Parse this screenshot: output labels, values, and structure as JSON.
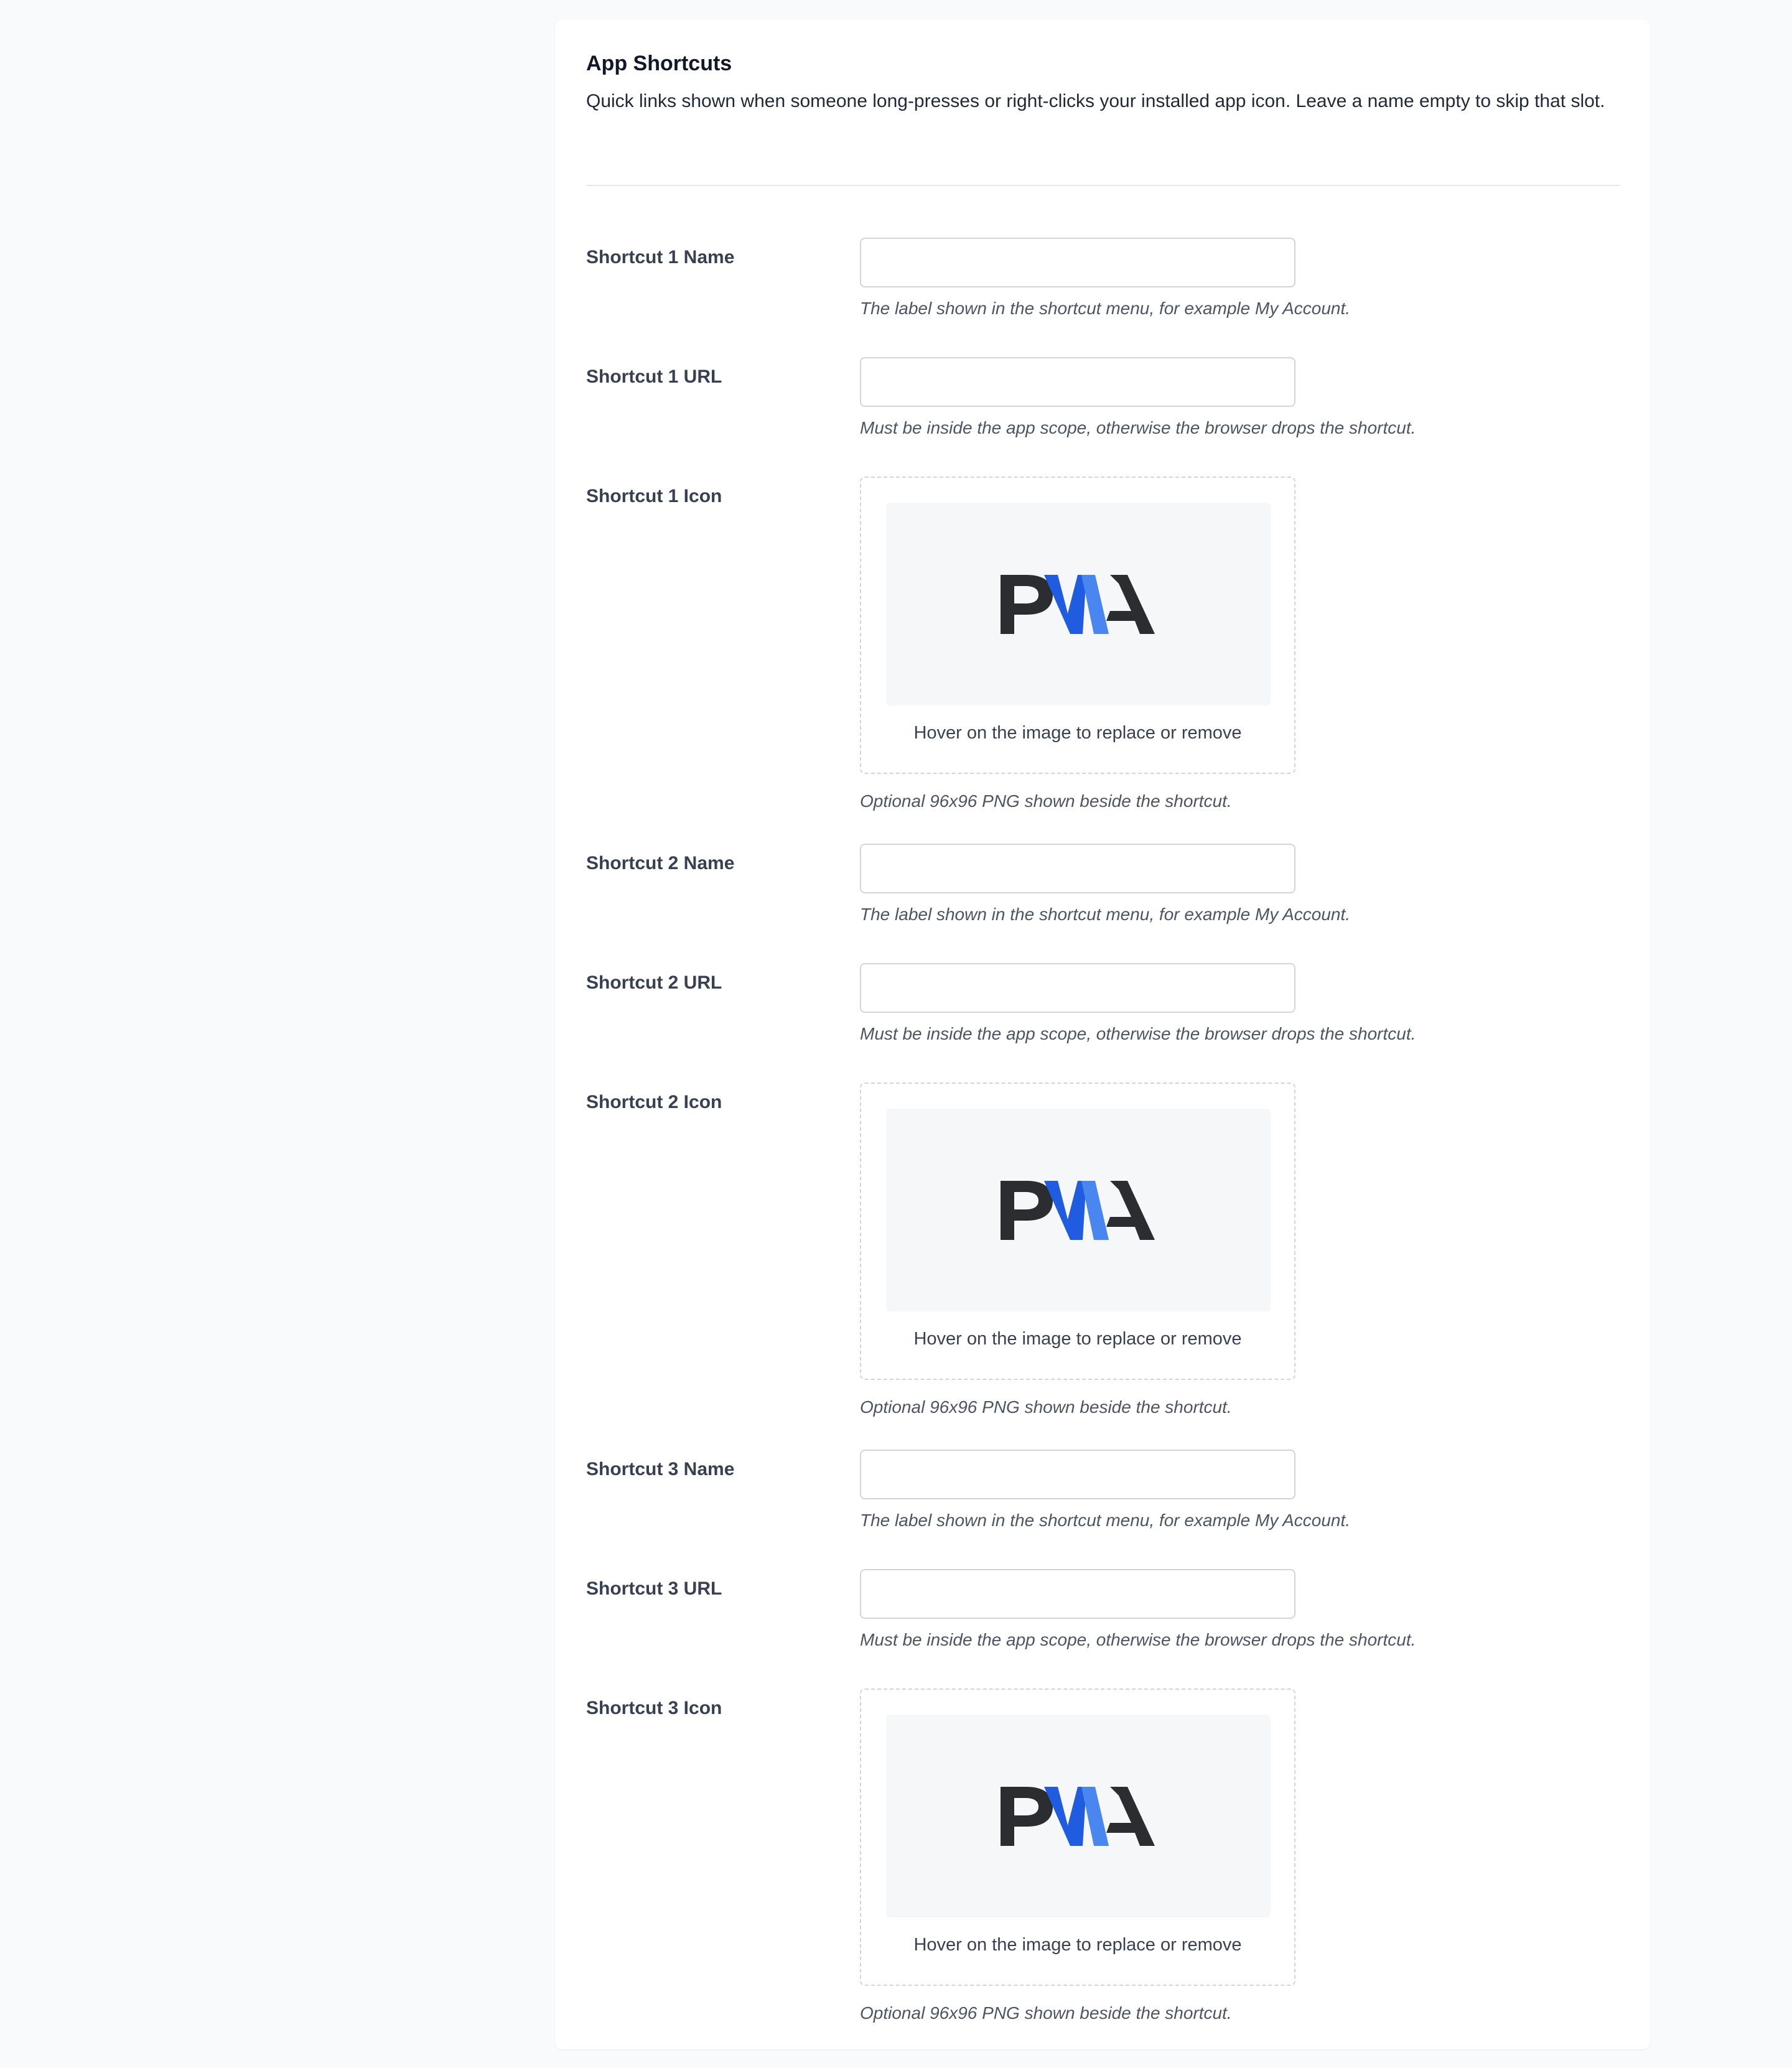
{
  "section": {
    "title": "App Shortcuts",
    "description": "Quick links shown when someone long-presses or right-clicks your installed app icon. Leave a name empty to skip that slot."
  },
  "shortcuts": [
    {
      "name_label": "Shortcut 1 Name",
      "name_value": "",
      "name_help": "The label shown in the shortcut menu, for example My Account.",
      "url_label": "Shortcut 1 URL",
      "url_value": "",
      "url_help": "Must be inside the app scope, otherwise the browser drops the shortcut.",
      "icon_label": "Shortcut 1 Icon",
      "icon_caption": "Hover on the image to replace or remove",
      "icon_help": "Optional 96x96 PNG shown beside the shortcut.",
      "icon_image": "pwa-logo"
    },
    {
      "name_label": "Shortcut 2 Name",
      "name_value": "",
      "name_help": "The label shown in the shortcut menu, for example My Account.",
      "url_label": "Shortcut 2 URL",
      "url_value": "",
      "url_help": "Must be inside the app scope, otherwise the browser drops the shortcut.",
      "icon_label": "Shortcut 2 Icon",
      "icon_caption": "Hover on the image to replace or remove",
      "icon_help": "Optional 96x96 PNG shown beside the shortcut.",
      "icon_image": "pwa-logo"
    },
    {
      "name_label": "Shortcut 3 Name",
      "name_value": "",
      "name_help": "The label shown in the shortcut menu, for example My Account.",
      "url_label": "Shortcut 3 URL",
      "url_value": "",
      "url_help": "Must be inside the app scope, otherwise the browser drops the shortcut.",
      "icon_label": "Shortcut 3 Icon",
      "icon_caption": "Hover on the image to replace or remove",
      "icon_help": "Optional 96x96 PNG shown beside the shortcut.",
      "icon_image": "pwa-logo"
    }
  ],
  "logo": {
    "text": "PWA",
    "dark_color": "#2b2d31",
    "blue_color": "#1f5ce0",
    "light_blue_color": "#4a86f0"
  },
  "colors": {
    "page_background": "#f8fafc",
    "card_background": "#ffffff",
    "border": "#d1d5db"
  }
}
